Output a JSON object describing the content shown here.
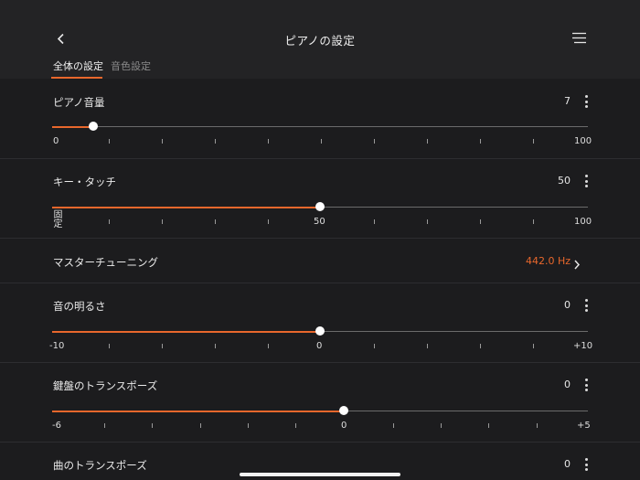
{
  "header": {
    "title": "ピアノの設定",
    "back_icon": "chevron-left-icon",
    "menu_icon": "hamburger-menu-icon"
  },
  "tabs": [
    {
      "label": "全体の設定",
      "active": true
    },
    {
      "label": "音色設定",
      "active": false
    }
  ],
  "accent_color": "#e8672c",
  "settings": {
    "piano_volume": {
      "label": "ピアノ音量",
      "value": "7",
      "min_label": "0",
      "max_label": "100",
      "min": 0,
      "max": 100,
      "current": 7
    },
    "key_touch": {
      "label": "キー・タッチ",
      "value": "50",
      "min_label": "固定",
      "mid_label": "50",
      "max_label": "100",
      "min": 0,
      "max": 100,
      "current": 50
    },
    "master_tuning": {
      "label": "マスターチューニング",
      "value": "442.0 Hz"
    },
    "brightness": {
      "label": "音の明るさ",
      "value": "0",
      "min_label": "-10",
      "mid_label": "0",
      "max_label": "+10",
      "min": -10,
      "max": 10,
      "current": 0
    },
    "keyboard_transpose": {
      "label": "鍵盤のトランスポーズ",
      "value": "0",
      "min_label": "-6",
      "mid_label": "0",
      "max_label": "+5",
      "min": -6,
      "max": 5,
      "current": 0
    },
    "song_transpose": {
      "label": "曲のトランスポーズ",
      "value": "0"
    }
  }
}
